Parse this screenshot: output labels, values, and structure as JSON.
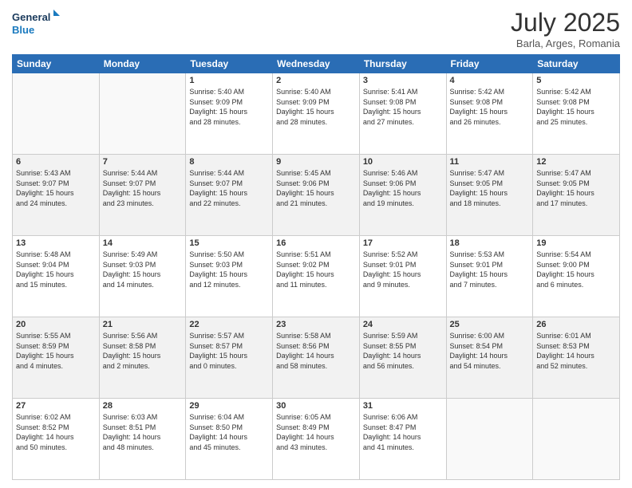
{
  "logo": {
    "line1": "General",
    "line2": "Blue"
  },
  "title": "July 2025",
  "subtitle": "Barla, Arges, Romania",
  "weekdays": [
    "Sunday",
    "Monday",
    "Tuesday",
    "Wednesday",
    "Thursday",
    "Friday",
    "Saturday"
  ],
  "weeks": [
    [
      {
        "day": "",
        "info": ""
      },
      {
        "day": "",
        "info": ""
      },
      {
        "day": "1",
        "info": "Sunrise: 5:40 AM\nSunset: 9:09 PM\nDaylight: 15 hours\nand 28 minutes."
      },
      {
        "day": "2",
        "info": "Sunrise: 5:40 AM\nSunset: 9:09 PM\nDaylight: 15 hours\nand 28 minutes."
      },
      {
        "day": "3",
        "info": "Sunrise: 5:41 AM\nSunset: 9:08 PM\nDaylight: 15 hours\nand 27 minutes."
      },
      {
        "day": "4",
        "info": "Sunrise: 5:42 AM\nSunset: 9:08 PM\nDaylight: 15 hours\nand 26 minutes."
      },
      {
        "day": "5",
        "info": "Sunrise: 5:42 AM\nSunset: 9:08 PM\nDaylight: 15 hours\nand 25 minutes."
      }
    ],
    [
      {
        "day": "6",
        "info": "Sunrise: 5:43 AM\nSunset: 9:07 PM\nDaylight: 15 hours\nand 24 minutes."
      },
      {
        "day": "7",
        "info": "Sunrise: 5:44 AM\nSunset: 9:07 PM\nDaylight: 15 hours\nand 23 minutes."
      },
      {
        "day": "8",
        "info": "Sunrise: 5:44 AM\nSunset: 9:07 PM\nDaylight: 15 hours\nand 22 minutes."
      },
      {
        "day": "9",
        "info": "Sunrise: 5:45 AM\nSunset: 9:06 PM\nDaylight: 15 hours\nand 21 minutes."
      },
      {
        "day": "10",
        "info": "Sunrise: 5:46 AM\nSunset: 9:06 PM\nDaylight: 15 hours\nand 19 minutes."
      },
      {
        "day": "11",
        "info": "Sunrise: 5:47 AM\nSunset: 9:05 PM\nDaylight: 15 hours\nand 18 minutes."
      },
      {
        "day": "12",
        "info": "Sunrise: 5:47 AM\nSunset: 9:05 PM\nDaylight: 15 hours\nand 17 minutes."
      }
    ],
    [
      {
        "day": "13",
        "info": "Sunrise: 5:48 AM\nSunset: 9:04 PM\nDaylight: 15 hours\nand 15 minutes."
      },
      {
        "day": "14",
        "info": "Sunrise: 5:49 AM\nSunset: 9:03 PM\nDaylight: 15 hours\nand 14 minutes."
      },
      {
        "day": "15",
        "info": "Sunrise: 5:50 AM\nSunset: 9:03 PM\nDaylight: 15 hours\nand 12 minutes."
      },
      {
        "day": "16",
        "info": "Sunrise: 5:51 AM\nSunset: 9:02 PM\nDaylight: 15 hours\nand 11 minutes."
      },
      {
        "day": "17",
        "info": "Sunrise: 5:52 AM\nSunset: 9:01 PM\nDaylight: 15 hours\nand 9 minutes."
      },
      {
        "day": "18",
        "info": "Sunrise: 5:53 AM\nSunset: 9:01 PM\nDaylight: 15 hours\nand 7 minutes."
      },
      {
        "day": "19",
        "info": "Sunrise: 5:54 AM\nSunset: 9:00 PM\nDaylight: 15 hours\nand 6 minutes."
      }
    ],
    [
      {
        "day": "20",
        "info": "Sunrise: 5:55 AM\nSunset: 8:59 PM\nDaylight: 15 hours\nand 4 minutes."
      },
      {
        "day": "21",
        "info": "Sunrise: 5:56 AM\nSunset: 8:58 PM\nDaylight: 15 hours\nand 2 minutes."
      },
      {
        "day": "22",
        "info": "Sunrise: 5:57 AM\nSunset: 8:57 PM\nDaylight: 15 hours\nand 0 minutes."
      },
      {
        "day": "23",
        "info": "Sunrise: 5:58 AM\nSunset: 8:56 PM\nDaylight: 14 hours\nand 58 minutes."
      },
      {
        "day": "24",
        "info": "Sunrise: 5:59 AM\nSunset: 8:55 PM\nDaylight: 14 hours\nand 56 minutes."
      },
      {
        "day": "25",
        "info": "Sunrise: 6:00 AM\nSunset: 8:54 PM\nDaylight: 14 hours\nand 54 minutes."
      },
      {
        "day": "26",
        "info": "Sunrise: 6:01 AM\nSunset: 8:53 PM\nDaylight: 14 hours\nand 52 minutes."
      }
    ],
    [
      {
        "day": "27",
        "info": "Sunrise: 6:02 AM\nSunset: 8:52 PM\nDaylight: 14 hours\nand 50 minutes."
      },
      {
        "day": "28",
        "info": "Sunrise: 6:03 AM\nSunset: 8:51 PM\nDaylight: 14 hours\nand 48 minutes."
      },
      {
        "day": "29",
        "info": "Sunrise: 6:04 AM\nSunset: 8:50 PM\nDaylight: 14 hours\nand 45 minutes."
      },
      {
        "day": "30",
        "info": "Sunrise: 6:05 AM\nSunset: 8:49 PM\nDaylight: 14 hours\nand 43 minutes."
      },
      {
        "day": "31",
        "info": "Sunrise: 6:06 AM\nSunset: 8:47 PM\nDaylight: 14 hours\nand 41 minutes."
      },
      {
        "day": "",
        "info": ""
      },
      {
        "day": "",
        "info": ""
      }
    ]
  ]
}
